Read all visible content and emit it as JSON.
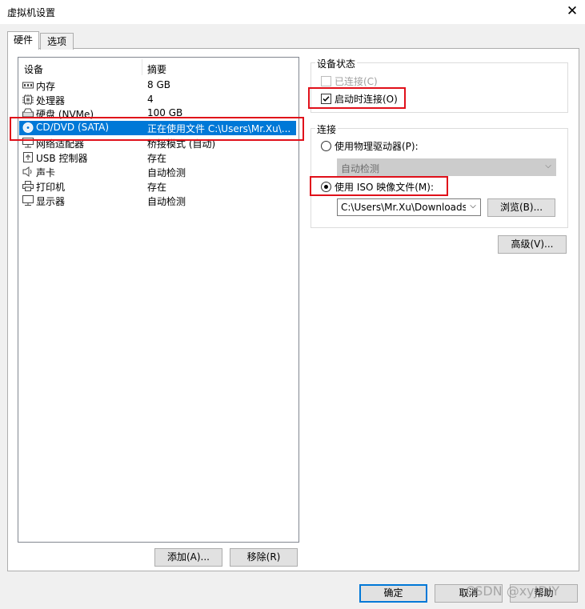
{
  "window": {
    "title": "虚拟机设置",
    "close_glyph": "✕"
  },
  "tabs": [
    {
      "label": "硬件"
    },
    {
      "label": "选项"
    }
  ],
  "device_list": {
    "col_device": "设备",
    "col_summary": "摘要",
    "rows": [
      {
        "name": "内存",
        "summary": "8 GB",
        "icon": "memory-icon"
      },
      {
        "name": "处理器",
        "summary": "4",
        "icon": "cpu-icon"
      },
      {
        "name": "硬盘 (NVMe)",
        "summary": "100 GB",
        "icon": "hard-disk-icon"
      },
      {
        "name": "CD/DVD (SATA)",
        "summary": "正在使用文件 C:\\Users\\Mr.Xu\\...",
        "icon": "cd-dvd-icon",
        "selected": true
      },
      {
        "name": "网络适配器",
        "summary": "桥接模式 (自动)",
        "icon": "network-adapter-icon"
      },
      {
        "name": "USB 控制器",
        "summary": "存在",
        "icon": "usb-icon"
      },
      {
        "name": "声卡",
        "summary": "自动检测",
        "icon": "speaker-icon"
      },
      {
        "name": "打印机",
        "summary": "存在",
        "icon": "printer-icon"
      },
      {
        "name": "显示器",
        "summary": "自动检测",
        "icon": "monitor-icon"
      }
    ]
  },
  "list_buttons": {
    "add": "添加(A)...",
    "remove": "移除(R)"
  },
  "device_status": {
    "legend": "设备状态",
    "connected": {
      "label": "已连接(C)",
      "checked": false,
      "disabled": true
    },
    "connect_at_power_on": {
      "label": "启动时连接(O)",
      "checked": true
    }
  },
  "connection": {
    "legend": "连接",
    "physical": {
      "label": "使用物理驱动器(P):",
      "selected": false
    },
    "physical_value": "自动检测",
    "iso": {
      "label": "使用 ISO 映像文件(M):",
      "selected": true
    },
    "iso_path": "C:\\Users\\Mr.Xu\\Downloads\\",
    "browse": "浏览(B)..."
  },
  "advanced_button": "高级(V)...",
  "footer": {
    "ok": "确定",
    "cancel": "取消",
    "help": "帮助"
  },
  "watermark": "CSDN @xyJDIY",
  "colors": {
    "selection": "#0078d7",
    "highlight_box": "#e0101a"
  }
}
